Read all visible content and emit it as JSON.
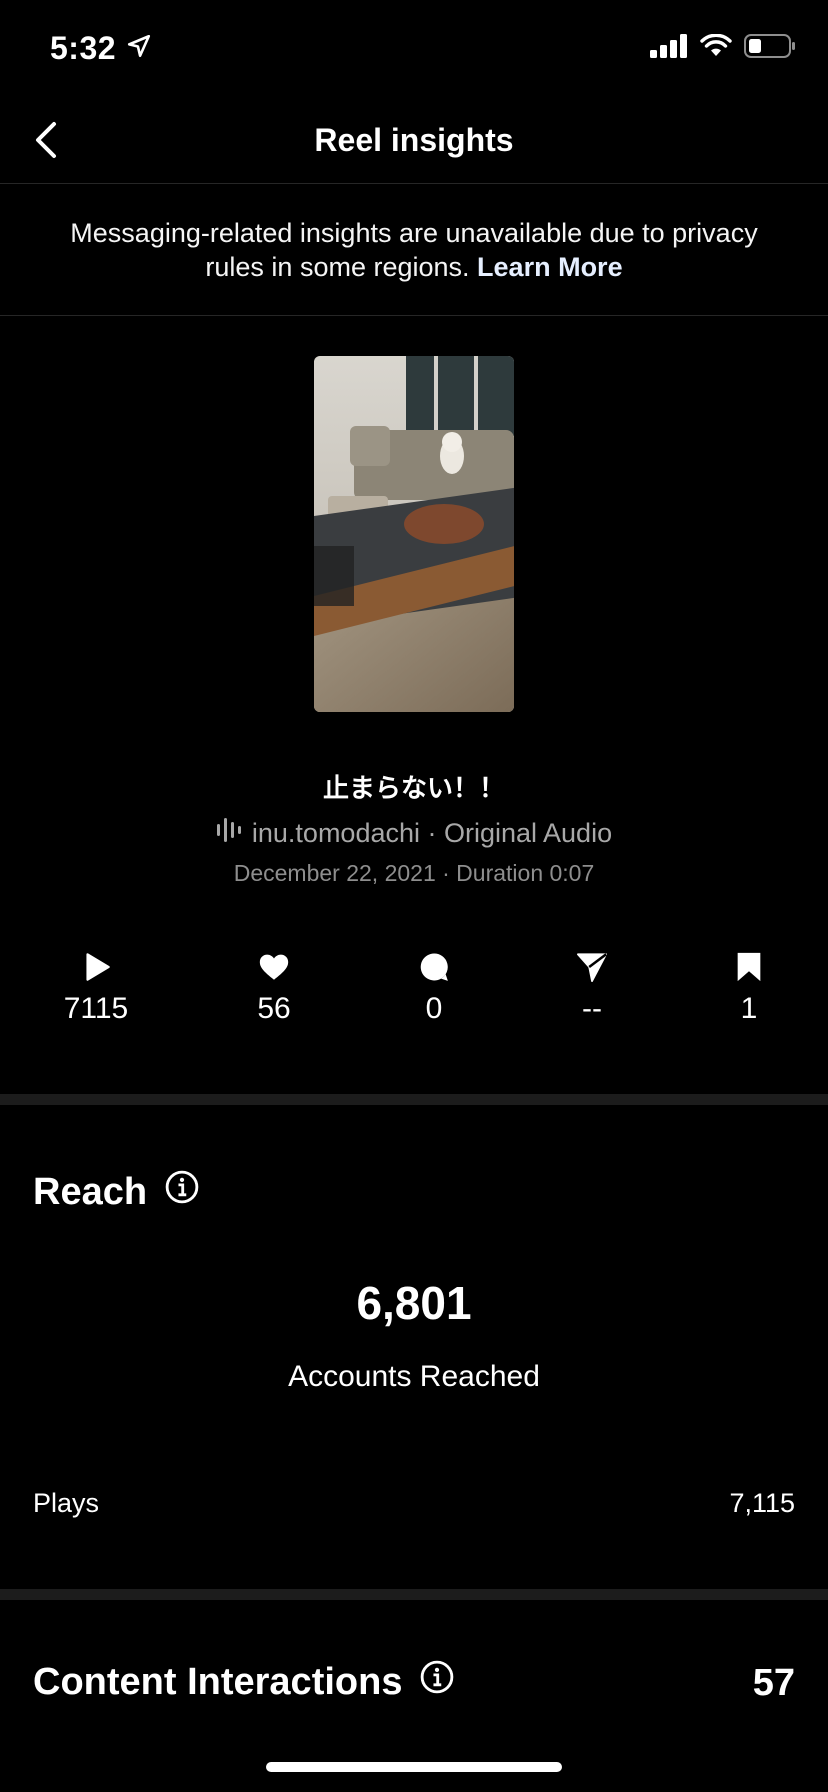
{
  "status_bar": {
    "time": "5:32",
    "icons": [
      "location-arrow-icon",
      "cellular-signal-icon",
      "wifi-icon",
      "battery-icon"
    ]
  },
  "header": {
    "title": "Reel insights",
    "back_icon": "chevron-left-icon"
  },
  "notice": {
    "text": "Messaging-related insights are unavailable due to privacy rules in some regions.",
    "link_label": "Learn More"
  },
  "reel": {
    "caption": "止まらない！！",
    "audio_icon": "audio-wave-icon",
    "audio": "inu.tomodachi · Original Audio",
    "meta": "December 22, 2021 · Duration 0:07"
  },
  "stats": [
    {
      "icon": "play-icon",
      "value": "7115"
    },
    {
      "icon": "heart-icon",
      "value": "56"
    },
    {
      "icon": "comment-icon",
      "value": "0"
    },
    {
      "icon": "share-icon",
      "value": "--"
    },
    {
      "icon": "bookmark-icon",
      "value": "1"
    }
  ],
  "reach": {
    "title": "Reach",
    "info_icon": "info-icon",
    "number": "6,801",
    "label": "Accounts Reached",
    "rows": [
      {
        "label": "Plays",
        "value": "7,115"
      }
    ]
  },
  "content_interactions": {
    "title": "Content Interactions",
    "info_icon": "info-icon",
    "value": "57"
  },
  "colors": {
    "background": "#000000",
    "text": "#ffffff",
    "muted": "#a8a8a8",
    "divider": "#1c1c1c"
  }
}
